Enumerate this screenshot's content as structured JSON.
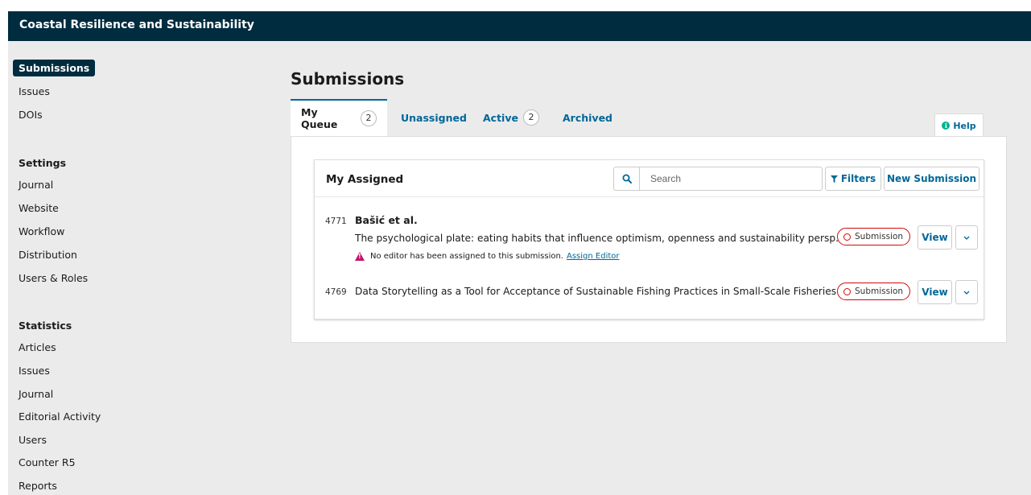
{
  "header": {
    "site_title": "Coastal Resilience and Sustainability"
  },
  "sidebar": {
    "main_items": [
      {
        "label": "Submissions",
        "active": true
      },
      {
        "label": "Issues"
      },
      {
        "label": "DOIs"
      }
    ],
    "settings": {
      "heading": "Settings",
      "items": [
        "Journal",
        "Website",
        "Workflow",
        "Distribution",
        "Users & Roles"
      ]
    },
    "statistics": {
      "heading": "Statistics",
      "items": [
        "Articles",
        "Issues",
        "Journal",
        "Editorial Activity",
        "Users",
        "Counter R5",
        "Reports"
      ]
    }
  },
  "main": {
    "page_title": "Submissions",
    "tabs": [
      {
        "label": "My Queue",
        "count": "2",
        "active": true
      },
      {
        "label": "Unassigned"
      },
      {
        "label": "Active",
        "count": "2"
      },
      {
        "label": "Archived"
      }
    ],
    "help_label": "Help",
    "list": {
      "title": "My Assigned",
      "search_placeholder": "Search",
      "filters_label": "Filters",
      "new_submission_label": "New Submission",
      "items": [
        {
          "id": "4771",
          "authors": "Bašić et al.",
          "title": "The psychological plate: eating habits that influence optimism, openness and sustainability persp...",
          "notice": "No editor has been assigned to this submission.",
          "notice_link": "Assign Editor",
          "stage": "Submission",
          "view_label": "View"
        },
        {
          "id": "4769",
          "title": "Data Storytelling as a Tool for Acceptance of Sustainable Fishing Practices in Small-Scale Fisheries",
          "stage": "Submission",
          "view_label": "View"
        }
      ]
    }
  },
  "colors": {
    "header_bg": "#002c40",
    "primary": "#006798",
    "stage_badge": "#d00a0a",
    "warning": "#c3146c",
    "help_icon": "#00b28d",
    "page_bg": "#ebebeb"
  }
}
